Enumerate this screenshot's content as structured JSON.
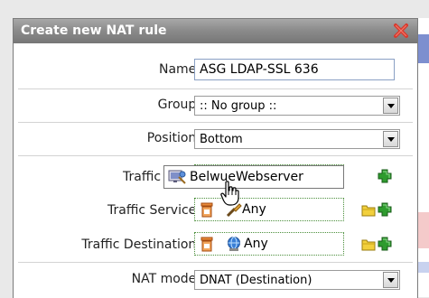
{
  "dialog": {
    "title": "Create new NAT rule"
  },
  "form": {
    "name": {
      "label": "Name:",
      "value": "ASG LDAP-SSL 636"
    },
    "group": {
      "label": "Group:",
      "value": ":: No group ::"
    },
    "position": {
      "label": "Position:",
      "value": "Bottom"
    },
    "traffic_source": {
      "label": "Traffic Sourc"
    },
    "traffic_service": {
      "label": "Traffic Service:",
      "value": "Any"
    },
    "traffic_destination": {
      "label": "Traffic Destination:",
      "value": "Any"
    },
    "nat_mode": {
      "label": "NAT mode:",
      "value": "DNAT (Destination)"
    }
  },
  "drag": {
    "item_label": "BelwueWebserver"
  },
  "colors": {
    "title_bar": "#8c8c8c",
    "close_red": "#d83a2e",
    "plus_green": "#2e9b2e",
    "dropzone_border": "#4c8f3c"
  }
}
